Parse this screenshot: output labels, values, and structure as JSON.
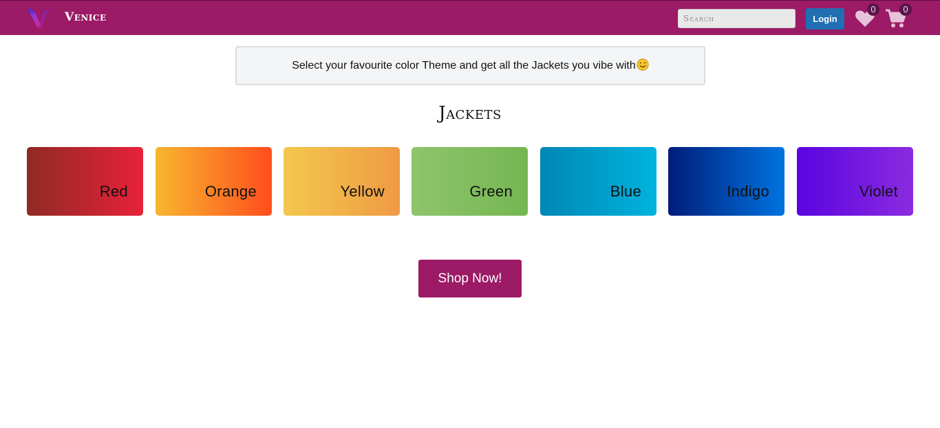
{
  "navbar": {
    "brand": "Venice",
    "search_placeholder": "Search",
    "login_label": "Login",
    "wishlist_count": "0",
    "cart_count": "0",
    "icons": [
      "venice-logo-icon",
      "heart-icon",
      "cart-icon"
    ],
    "colors": {
      "bar": "#9c1a66",
      "login": "#1f6fb2"
    }
  },
  "notice": {
    "text": "Select your favourite color Theme and get all the Jackets you vibe with",
    "emoji_icon": "smiling-face-icon"
  },
  "heading": "Jackets",
  "tiles": [
    {
      "label": "Red",
      "from": "#8f2a24",
      "to": "#e8213a"
    },
    {
      "label": "Orange",
      "from": "#f8b62f",
      "to": "#ff4d1c"
    },
    {
      "label": "Yellow",
      "from": "#f3c84c",
      "to": "#ef9a45"
    },
    {
      "label": "Green",
      "from": "#8fc46d",
      "to": "#74b752"
    },
    {
      "label": "Blue",
      "from": "#0087b4",
      "to": "#00b3de"
    },
    {
      "label": "Indigo",
      "from": "#001d7a",
      "to": "#0073e0"
    },
    {
      "label": "Violet",
      "from": "#5a04e0",
      "to": "#8b2be0"
    }
  ],
  "shop_button": "Shop Now!"
}
